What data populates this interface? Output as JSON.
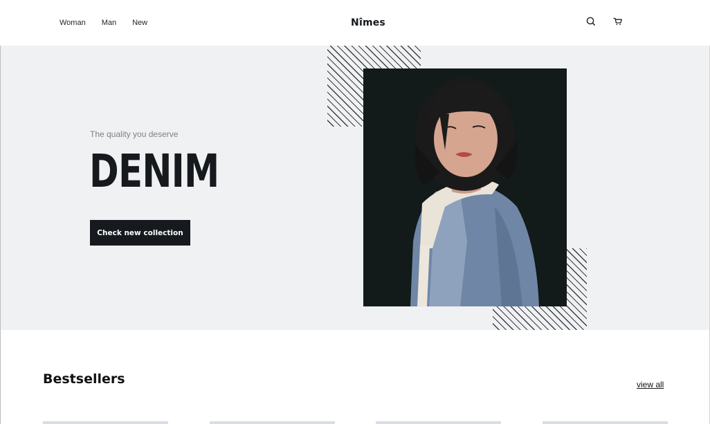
{
  "header": {
    "nav": [
      {
        "label": "Woman"
      },
      {
        "label": "Man"
      },
      {
        "label": "New"
      }
    ],
    "logo": "Nîmes",
    "icons": [
      "search-icon",
      "cart-icon"
    ]
  },
  "hero": {
    "tagline": "The quality you deserve",
    "title": "DENIM",
    "cta_label": "Check new collection",
    "image": "woman-in-denim-jacket-photo"
  },
  "bestsellers": {
    "title": "Bestsellers",
    "view_all": "view all"
  },
  "colors": {
    "accent": "#16191d",
    "hero_bg": "#f0f1f3",
    "muted_text": "#7d8187",
    "photo_bg": "#121a1a"
  }
}
